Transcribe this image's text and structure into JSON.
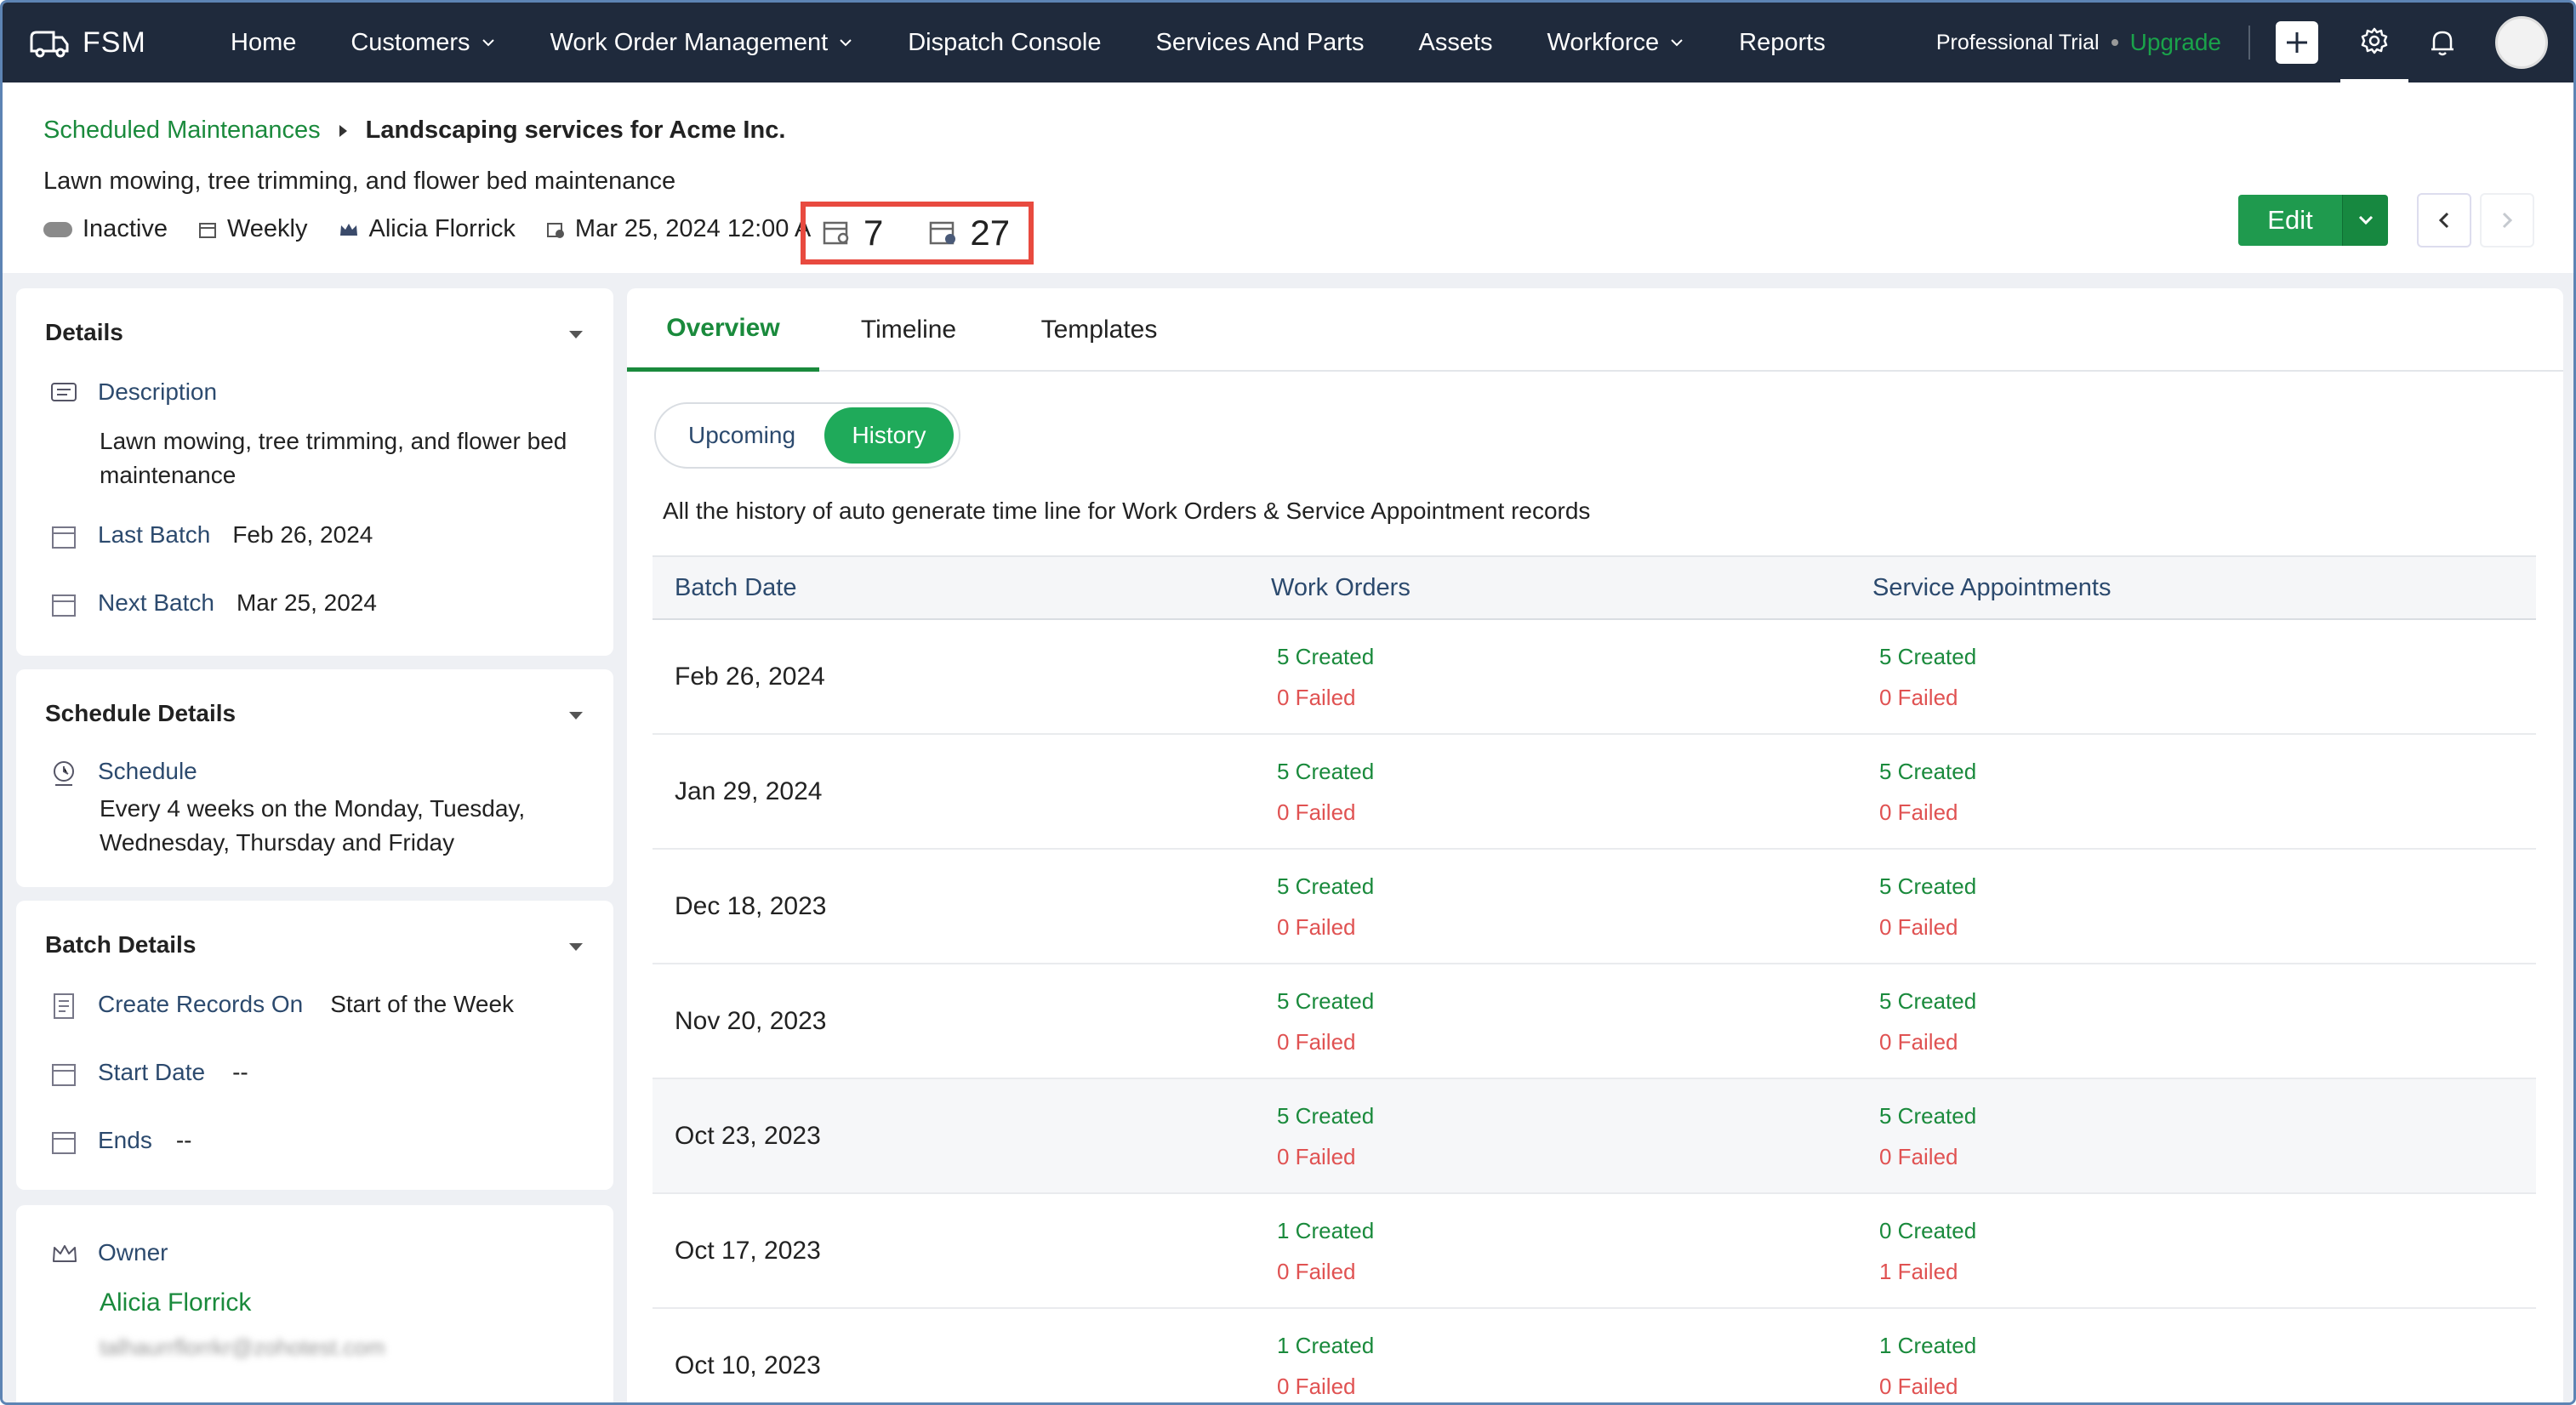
{
  "nav": {
    "logo": "FSM",
    "items": [
      {
        "label": "Home",
        "dropdown": false
      },
      {
        "label": "Customers",
        "dropdown": true
      },
      {
        "label": "Work Order Management",
        "dropdown": true
      },
      {
        "label": "Dispatch Console",
        "dropdown": false
      },
      {
        "label": "Services And Parts",
        "dropdown": false
      },
      {
        "label": "Assets",
        "dropdown": false
      },
      {
        "label": "Workforce",
        "dropdown": true
      },
      {
        "label": "Reports",
        "dropdown": false
      }
    ],
    "trial": "Professional Trial",
    "upgrade": "Upgrade"
  },
  "header": {
    "breadcrumb_parent": "Scheduled Maintenances",
    "breadcrumb_current": "Landscaping services for Acme Inc.",
    "subtitle": "Lawn mowing, tree trimming, and flower bed maintenance",
    "status": "Inactive",
    "frequency": "Weekly",
    "owner": "Alicia Florrick",
    "date": "Mar 25, 2024 12:00 A",
    "work_order_count": "7",
    "appointment_count": "27",
    "edit_label": "Edit"
  },
  "details": {
    "title": "Details",
    "description_label": "Description",
    "description_value": "Lawn mowing, tree trimming, and flower bed maintenance",
    "last_batch_label": "Last Batch",
    "last_batch_value": "Feb 26, 2024",
    "next_batch_label": "Next Batch",
    "next_batch_value": "Mar 25, 2024"
  },
  "schedule_details": {
    "title": "Schedule Details",
    "schedule_label": "Schedule",
    "schedule_value": "Every 4 weeks on the Monday, Tuesday, Wednesday, Thursday and Friday"
  },
  "batch_details": {
    "title": "Batch Details",
    "create_label": "Create Records On",
    "create_value": "Start of the Week",
    "start_label": "Start Date",
    "start_value": "--",
    "ends_label": "Ends",
    "ends_value": "--"
  },
  "owner_card": {
    "label": "Owner",
    "name": "Alicia Florrick",
    "email": "talhaurrflorrkr@zohotest.com"
  },
  "tabs": [
    "Overview",
    "Timeline",
    "Templates"
  ],
  "toggle": {
    "upcoming": "Upcoming",
    "history": "History"
  },
  "history_note": "All the history of auto generate time line for Work Orders & Service Appointment records",
  "table": {
    "headers": [
      "Batch Date",
      "Work Orders",
      "Service Appointments"
    ],
    "rows": [
      {
        "date": "Feb 26, 2024",
        "wo_created": "5 Created",
        "wo_failed": "0 Failed",
        "sa_created": "5 Created",
        "sa_failed": "0 Failed"
      },
      {
        "date": "Jan 29, 2024",
        "wo_created": "5 Created",
        "wo_failed": "0 Failed",
        "sa_created": "5 Created",
        "sa_failed": "0 Failed"
      },
      {
        "date": "Dec 18, 2023",
        "wo_created": "5 Created",
        "wo_failed": "0 Failed",
        "sa_created": "5 Created",
        "sa_failed": "0 Failed"
      },
      {
        "date": "Nov 20, 2023",
        "wo_created": "5 Created",
        "wo_failed": "0 Failed",
        "sa_created": "5 Created",
        "sa_failed": "0 Failed"
      },
      {
        "date": "Oct 23, 2023",
        "wo_created": "5 Created",
        "wo_failed": "0 Failed",
        "sa_created": "5 Created",
        "sa_failed": "0 Failed"
      },
      {
        "date": "Oct 17, 2023",
        "wo_created": "1 Created",
        "wo_failed": "0 Failed",
        "sa_created": "0 Created",
        "sa_failed": "1 Failed"
      },
      {
        "date": "Oct 10, 2023",
        "wo_created": "1 Created",
        "wo_failed": "0 Failed",
        "sa_created": "1 Created",
        "sa_failed": "0 Failed"
      }
    ]
  },
  "colors": {
    "nav_bg": "#1f2a3c",
    "brand_green": "#1a8a3c",
    "fail_red": "#e05252",
    "highlight": "#e84a3f"
  }
}
